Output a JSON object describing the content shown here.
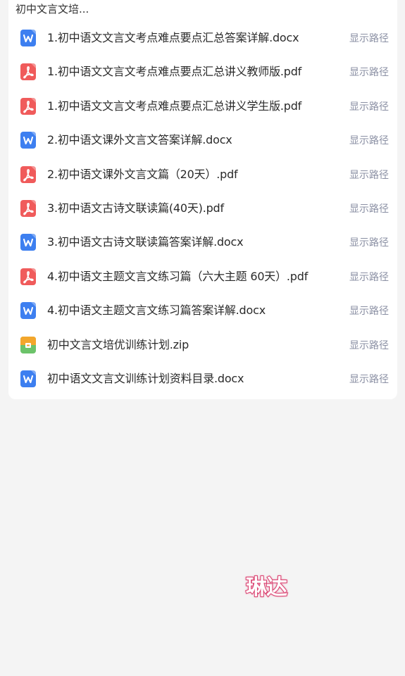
{
  "folder": {
    "title": "初中文言文培..."
  },
  "files": [
    {
      "name": "1.初中语文文言文考点难点要点汇总答案详解.docx",
      "type": "docx",
      "action": "显示路径"
    },
    {
      "name": "1.初中语文文言文考点难点要点汇总讲义教师版.pdf",
      "type": "pdf",
      "action": "显示路径"
    },
    {
      "name": "1.初中语文文言文考点难点要点汇总讲义学生版.pdf",
      "type": "pdf",
      "action": "显示路径"
    },
    {
      "name": "2.初中语文课外文言文答案详解.docx",
      "type": "docx",
      "action": "显示路径"
    },
    {
      "name": "2.初中语文课外文言文篇（20天）.pdf",
      "type": "pdf",
      "action": "显示路径"
    },
    {
      "name": "3.初中语文古诗文联读篇(40天).pdf",
      "type": "pdf",
      "action": "显示路径"
    },
    {
      "name": "3.初中语文古诗文联读篇答案详解.docx",
      "type": "docx",
      "action": "显示路径"
    },
    {
      "name": "4.初中语文主题文言文练习篇（六大主题 60天）.pdf",
      "type": "pdf",
      "action": "显示路径"
    },
    {
      "name": "4.初中语文主题文言文练习篇答案详解.docx",
      "type": "docx",
      "action": "显示路径"
    },
    {
      "name": "初中文言文培优训练计划.zip",
      "type": "zip",
      "action": "显示路径"
    },
    {
      "name": "初中语文文言文训练计划资料目录.docx",
      "type": "docx",
      "action": "显示路径"
    }
  ],
  "watermark": {
    "text": "琳达"
  },
  "colors": {
    "docx_icon": "#3d7ff0",
    "pdf_icon": "#f05b5b",
    "zip_icon_top": "#f3a62c",
    "zip_icon_bottom": "#6cc36a",
    "path_link": "#8a8fa3"
  }
}
